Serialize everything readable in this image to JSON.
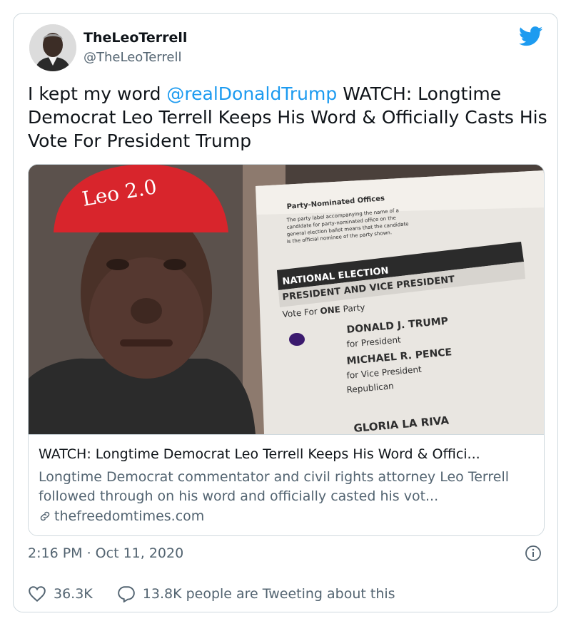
{
  "author": {
    "display_name": "TheLeoTerrell",
    "handle": "@TheLeoTerrell"
  },
  "tweet": {
    "text_before": "I kept my word ",
    "mention": "@realDonaldTrump",
    "text_after": " WATCH: Longtime Democrat Leo Terrell Keeps His Word & Officially Casts His Vote For President Trump",
    "timestamp": "2:16 PM · Oct 11, 2020"
  },
  "card": {
    "title": "WATCH: Longtime Democrat Leo Terrell Keeps His Word & Offici...",
    "description": "Longtime Democrat commentator and civil rights attorney Leo Terrell followed through on his word and officially casted his vot...",
    "domain": "thefreedomtimes.com",
    "image": {
      "hat_text": "Leo 2.0",
      "ballot_heading": "Party-Nominated Offices",
      "ballot_note": "The party label accompanying the name of a candidate for party-nominated office on the general election ballot means that the candidate is the official nominee of the party shown.",
      "ballot_section": "NATIONAL ELECTION",
      "ballot_office": "PRESIDENT AND VICE PRESIDENT",
      "ballot_vote_prefix": "Vote For ",
      "ballot_vote_strong": "ONE",
      "ballot_vote_suffix": " Party",
      "candidate_1": "DONALD J. TRUMP",
      "candidate_1_role": "for President",
      "candidate_2": "MICHAEL R. PENCE",
      "candidate_2_role": "for Vice President",
      "party": "Republican",
      "next_candidate": "GLORIA LA RIVA"
    }
  },
  "engagement": {
    "likes": "36.3K",
    "tweeting": "13.8K people are Tweeting about this"
  },
  "colors": {
    "accent": "#1d9bf0",
    "text": "#0f1419",
    "secondary": "#536471",
    "border": "#cfd9de",
    "hat_red": "#d8252c"
  },
  "icons": [
    "twitter-bird-icon",
    "link-icon",
    "info-icon",
    "heart-icon",
    "reply-bubble-icon"
  ]
}
